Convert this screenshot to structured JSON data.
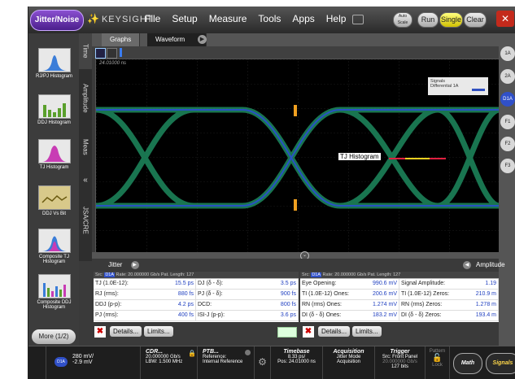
{
  "app": {
    "badge": "Jitter/Noise",
    "brand": "KEYSIGHT",
    "menu": [
      "File",
      "Setup",
      "Measure",
      "Tools",
      "Apps",
      "Help"
    ],
    "buttons": {
      "auto_scale": "Auto Scale",
      "run": "Run",
      "single": "Single",
      "clear": "Clear"
    }
  },
  "sidebar": {
    "items": [
      {
        "label": "RJ/PJ Histogram",
        "icon": "gaussian-histogram-icon"
      },
      {
        "label": "DDJ Histogram",
        "icon": "bar-histogram-icon"
      },
      {
        "label": "TJ Histogram",
        "icon": "pink-histogram-icon"
      },
      {
        "label": "DDJ Vs Bit",
        "icon": "waveform-bit-icon"
      },
      {
        "label": "Composite TJ Histogram",
        "icon": "composite-histogram-icon"
      },
      {
        "label": "Composite DDJ Histogram",
        "icon": "composite-bar-icon"
      }
    ],
    "more": "More (1/2)"
  },
  "vtabs": [
    "Time",
    "Amplitude",
    "Meas",
    "JSA/CRE"
  ],
  "graph_tabs": [
    "Graphs",
    "Waveform"
  ],
  "plot": {
    "time_label": "24.01000 ns",
    "legend_title": "Signals",
    "legend_item": "Differential 1A",
    "marker_label": "TJ Histogram"
  },
  "right_buttons": [
    "1A",
    "2A",
    "D1A",
    "F1",
    "F2",
    "F3"
  ],
  "jitter_panel": {
    "title": "Jitter",
    "src_tag": "D1A",
    "src_text": "Rate: 20.000000 Gb/s   Pat. Length: 127",
    "src_label": "Src:",
    "rows": [
      [
        {
          "k": "TJ (1.0E-12):",
          "v": "15.5 ps"
        },
        {
          "k": "DJ (δ - δ):",
          "v": "3.5 ps"
        }
      ],
      [
        {
          "k": "RJ (rms):",
          "v": "880 fs"
        },
        {
          "k": "PJ (δ - δ):",
          "v": "900 fs"
        }
      ],
      [
        {
          "k": "DDJ (p-p):",
          "v": "4.2 ps"
        },
        {
          "k": "DCD:",
          "v": "800 fs"
        }
      ],
      [
        {
          "k": "PJ (rms):",
          "v": "400 fs"
        },
        {
          "k": "ISI-J (p-p):",
          "v": "3.6 ps"
        }
      ]
    ],
    "details": "Details...",
    "limits": "Limits..."
  },
  "amplitude_panel": {
    "title": "Amplitude",
    "src_tag": "D1A",
    "src_label": "Src:",
    "src_text": "Rate: 20.000000 Gb/s   Pat. Length: 127",
    "rows": [
      [
        {
          "k": "Eye Opening:",
          "v": "990.6 mV"
        },
        {
          "k": "Signal Amplitude:",
          "v": "1.19"
        }
      ],
      [
        {
          "k": "TI (1.0E-12) Ones:",
          "v": "200.6 mV"
        },
        {
          "k": "TI (1.0E-12) Zeros:",
          "v": "210.9 m"
        }
      ],
      [
        {
          "k": "RN (rms) Ones:",
          "v": "1.274 mV"
        },
        {
          "k": "RN (rms) Zeros:",
          "v": "1.278 m"
        }
      ],
      [
        {
          "k": "DI (δ - δ) Ones:",
          "v": "183.2 mV"
        },
        {
          "k": "DI (δ - δ) Zeros:",
          "v": "193.4 m"
        }
      ]
    ],
    "details": "Details...",
    "limits": "Limits..."
  },
  "status": {
    "channel_tag": "D1A",
    "channel_scale": "280 mV/",
    "channel_offset": "-2.9 mV",
    "cdr_title": "CDR...",
    "cdr_rate": "20.000000 Gb/s",
    "cdr_lbw": "LBW: 1.500 MHz",
    "ptb_title": "PTB...",
    "ptb_ref1": "Reference:",
    "ptb_ref2": "Internal Reference",
    "timebase_title": "Timebase",
    "timebase_scale": "8.33 ps/",
    "timebase_pos": "Pos: 24.01000 ns",
    "acq_title": "Acquisition",
    "acq_mode": "Jitter Mode",
    "acq_sub": "Acquisition",
    "trig_title": "Trigger",
    "trig_src": "Src: Front Panel",
    "trig_rate": "20.000000 Gb/s",
    "trig_bits": "127 bits",
    "pattern": "Pattern",
    "lock": "Lock",
    "math": "Math",
    "signals": "Signals"
  }
}
